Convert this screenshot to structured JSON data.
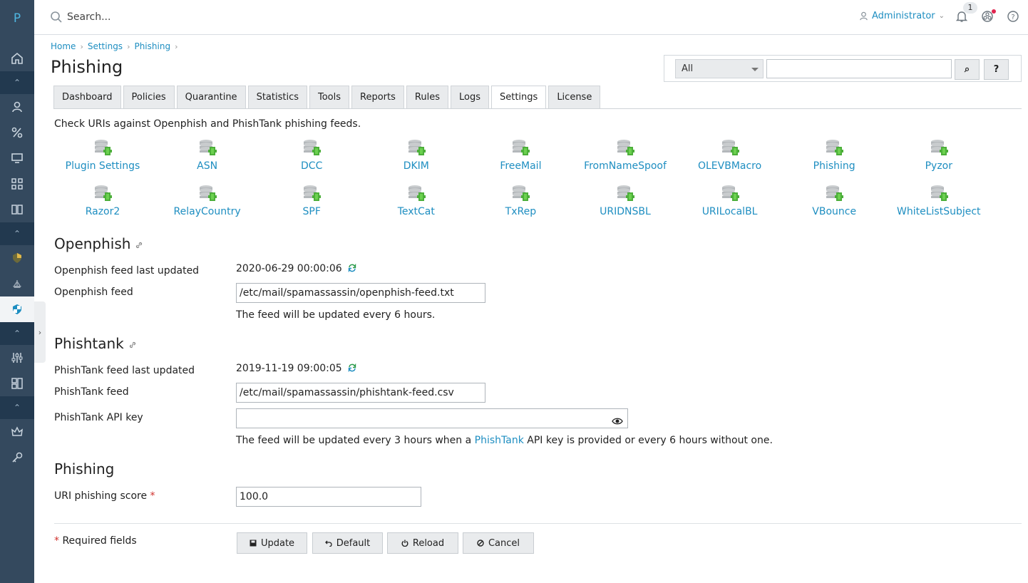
{
  "sidebar": {
    "logo": "P",
    "items": [
      "home-icon",
      "users-icon",
      "percent-icon",
      "monitor-icon",
      "apps-icon",
      "book-icon",
      "shield-icon",
      "ship-icon",
      "shield-active-icon",
      "sliders-icon",
      "layout-icon",
      "crown-icon",
      "key-icon"
    ]
  },
  "topbar": {
    "search_placeholder": "Search...",
    "user": "Administrator",
    "notification_count": "1"
  },
  "breadcrumb": [
    "Home",
    "Settings",
    "Phishing"
  ],
  "page_title": "Phishing",
  "filter": {
    "select_value": "All",
    "search_value": "",
    "search_button": "⌕",
    "help_button": "?"
  },
  "tabs": [
    "Dashboard",
    "Policies",
    "Quarantine",
    "Statistics",
    "Tools",
    "Reports",
    "Rules",
    "Logs",
    "Settings",
    "License"
  ],
  "active_tab": "Settings",
  "intro": "Check URIs against Openphish and PhishTank phishing feeds.",
  "plugins_row1": [
    "Plugin Settings",
    "ASN",
    "DCC",
    "DKIM",
    "FreeMail",
    "FromNameSpoof",
    "OLEVBMacro",
    "Phishing",
    "Pyzor"
  ],
  "plugins_row2": [
    "Razor2",
    "RelayCountry",
    "SPF",
    "TextCat",
    "TxRep",
    "URIDNSBL",
    "URILocalBL",
    "VBounce",
    "WhiteListSubject"
  ],
  "openphish": {
    "title": "Openphish",
    "last_updated_label": "Openphish feed last updated",
    "last_updated_value": "2020-06-29 00:00:06",
    "feed_label": "Openphish feed",
    "feed_value": "/etc/mail/spamassassin/openphish-feed.txt",
    "hint": "The feed will be updated every 6 hours."
  },
  "phishtank": {
    "title": "Phishtank",
    "last_updated_label": "PhishTank feed last updated",
    "last_updated_value": "2019-11-19 09:00:05",
    "feed_label": "PhishTank feed",
    "feed_value": "/etc/mail/spamassassin/phishtank-feed.csv",
    "api_key_label": "PhishTank API key",
    "api_key_value": "",
    "hint_before": "The feed will be updated every 3 hours when a ",
    "hint_link": "PhishTank",
    "hint_after": " API key is provided or every 6 hours without one."
  },
  "phishing": {
    "title": "Phishing",
    "score_label": "URI phishing score",
    "score_value": "100.0"
  },
  "required_note": "Required fields",
  "required_mark": "*",
  "buttons": {
    "update": "Update",
    "default": "Default",
    "reload": "Reload",
    "cancel": "Cancel"
  }
}
